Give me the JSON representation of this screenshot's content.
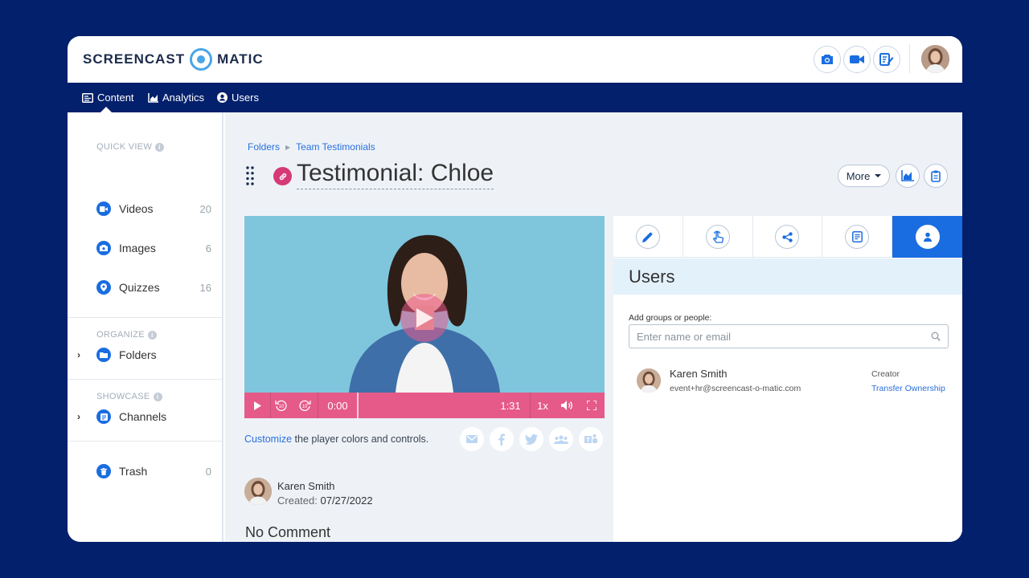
{
  "brand": {
    "left": "SCREENCAST",
    "right": "MATIC"
  },
  "colors": {
    "accent": "#1a6de0",
    "nav": "#03206c",
    "video_bar": "#e55a88",
    "link_badge": "#d53a76"
  },
  "toolbar": {
    "icons": [
      "camera-icon",
      "video-camera-icon",
      "edit-document-icon"
    ]
  },
  "nav": {
    "items": [
      {
        "label": "Content"
      },
      {
        "label": "Analytics"
      },
      {
        "label": "Users"
      }
    ]
  },
  "sidebar": {
    "quick_view": "QUICK VIEW",
    "organize": "ORGANIZE",
    "showcase": "SHOWCASE",
    "items": [
      {
        "label": "Videos",
        "count": "20"
      },
      {
        "label": "Images",
        "count": "6"
      },
      {
        "label": "Quizzes",
        "count": "16"
      },
      {
        "label": "Folders"
      },
      {
        "label": "Channels"
      },
      {
        "label": "Trash",
        "count": "0"
      }
    ]
  },
  "breadcrumb": {
    "folders": "Folders",
    "current": "Team Testimonials"
  },
  "page": {
    "title": "Testimonial: Chloe",
    "more": "More"
  },
  "player": {
    "time": "0:00",
    "duration": "1:31",
    "speed": "1x",
    "progress": 0
  },
  "customize": {
    "link": "Customize",
    "text": " the player colors and controls."
  },
  "creator": {
    "name": "Karen Smith",
    "created_label": "Created: ",
    "date": "07/27/2022"
  },
  "comment": "No Comment",
  "users_panel": {
    "title": "Users",
    "add_label": "Add groups or people:",
    "search_placeholder": "Enter name or email",
    "user": {
      "name": "Karen Smith",
      "email": "event+hr@screencast-o-matic.com",
      "role": "Creator",
      "action": "Transfer Ownership"
    }
  }
}
